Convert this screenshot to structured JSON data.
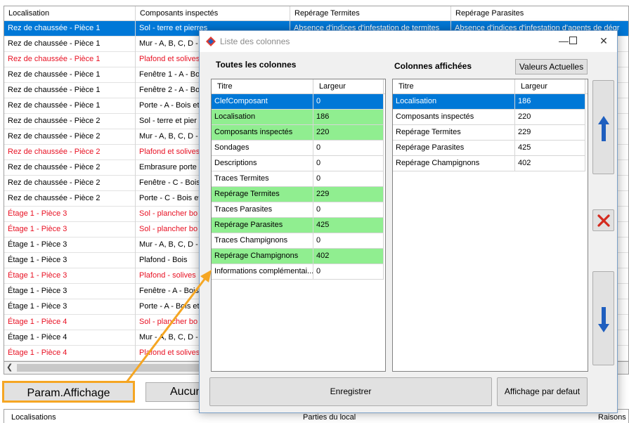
{
  "background": {
    "columns": [
      "Localisation",
      "Composants inspectés",
      "Repérage Termites",
      "Repérage Parasites"
    ],
    "rows": [
      {
        "loc": "Rez de chaussée - Pièce 1",
        "comp": "Sol - terre et pierres",
        "termites": "Absence d'indices d'infestation de termites",
        "parasites": "Absence d'indices d'infestation d'agents de dégr",
        "style": "selected"
      },
      {
        "loc": "Rez de chaussée - Pièce 1",
        "comp": "Mur - A, B, C, D -",
        "termites": "",
        "parasites": "",
        "style": "normal"
      },
      {
        "loc": "Rez de chaussée - Pièce 1",
        "comp": "Plafond et solives",
        "termites": "",
        "parasites": "ur",
        "style": "red"
      },
      {
        "loc": "Rez de chaussée - Pièce 1",
        "comp": "Fenêtre 1 - A - Bo",
        "termites": "",
        "parasites": "égr",
        "style": "normal"
      },
      {
        "loc": "Rez de chaussée - Pièce 1",
        "comp": "Fenêtre 2 - A - Bo",
        "termites": "",
        "parasites": "égr",
        "style": "normal"
      },
      {
        "loc": "Rez de chaussée - Pièce 1",
        "comp": "Porte - A - Bois et",
        "termites": "",
        "parasites": "égr",
        "style": "normal"
      },
      {
        "loc": "Rez de chaussée - Pièce 2",
        "comp": "Sol - terre et pier",
        "termites": "",
        "parasites": "égr",
        "style": "normal"
      },
      {
        "loc": "Rez de chaussée - Pièce 2",
        "comp": "Mur - A, B, C, D -",
        "termites": "",
        "parasites": "égr",
        "style": "normal"
      },
      {
        "loc": "Rez de chaussée - Pièce 2",
        "comp": "Plafond et solives",
        "termites": "",
        "parasites": "ur",
        "style": "red"
      },
      {
        "loc": "Rez de chaussée - Pièce 2",
        "comp": "Embrasure porte",
        "termites": "",
        "parasites": "égr",
        "style": "normal"
      },
      {
        "loc": "Rez de chaussée - Pièce 2",
        "comp": "Fenêtre - C - Bois",
        "termites": "",
        "parasites": "égr",
        "style": "normal"
      },
      {
        "loc": "Rez de chaussée - Pièce 2",
        "comp": "Porte - C - Bois et",
        "termites": "",
        "parasites": "égr",
        "style": "normal"
      },
      {
        "loc": "Étage 1 - Pièce 3",
        "comp": "Sol - plancher bo",
        "termites": "",
        "parasites": "ur",
        "style": "red"
      },
      {
        "loc": "Étage 1 - Pièce 3",
        "comp": "Sol - plancher bo",
        "termites": "",
        "parasites": "ur",
        "style": "red"
      },
      {
        "loc": "Étage 1 - Pièce 3",
        "comp": "Mur - A, B, C, D -",
        "termites": "",
        "parasites": "égr",
        "style": "normal"
      },
      {
        "loc": "Étage 1 - Pièce 3",
        "comp": "Plafond - Bois",
        "termites": "",
        "parasites": "égr",
        "style": "normal"
      },
      {
        "loc": "Étage 1 - Pièce 3",
        "comp": "Plafond - solives",
        "termites": "",
        "parasites": "ur",
        "style": "red"
      },
      {
        "loc": "Étage 1 - Pièce 3",
        "comp": "Fenêtre - A - Bois",
        "termites": "",
        "parasites": "égr",
        "style": "normal"
      },
      {
        "loc": "Étage 1 - Pièce 3",
        "comp": "Porte - A - Bois et",
        "termites": "",
        "parasites": "égr",
        "style": "normal"
      },
      {
        "loc": "Étage 1 - Pièce 4",
        "comp": "Sol - plancher bo",
        "termites": "",
        "parasites": "ur",
        "style": "red"
      },
      {
        "loc": "Étage 1 - Pièce 4",
        "comp": "Mur - A, B, C, D -",
        "termites": "",
        "parasites": "égr",
        "style": "normal"
      },
      {
        "loc": "Étage 1 - Pièce 4",
        "comp": "Plafond et solives",
        "termites": "",
        "parasites": "ur",
        "style": "red"
      }
    ],
    "param_button": "Param.Affichage",
    "aucun_button": "Aucun",
    "bottom_headers": [
      "Localisations",
      "Parties du local",
      "Raisons"
    ]
  },
  "dialog": {
    "title": "Liste des colonnes",
    "left_label": "Toutes les colonnes",
    "right_label": "Colonnes affichées",
    "valeurs_button": "Valeurs Actuelles",
    "col_titre": "Titre",
    "col_largeur": "Largeur",
    "all_columns": [
      {
        "titre": "ClefComposant",
        "largeur": "0",
        "state": "selected"
      },
      {
        "titre": "Localisation",
        "largeur": "186",
        "state": "displayed"
      },
      {
        "titre": "Composants inspectés",
        "largeur": "220",
        "state": "displayed"
      },
      {
        "titre": "Sondages",
        "largeur": "0",
        "state": "normal"
      },
      {
        "titre": "Descriptions",
        "largeur": "0",
        "state": "normal"
      },
      {
        "titre": "Traces Termites",
        "largeur": "0",
        "state": "normal"
      },
      {
        "titre": "Repérage Termites",
        "largeur": "229",
        "state": "displayed"
      },
      {
        "titre": "Traces Parasites",
        "largeur": "0",
        "state": "normal"
      },
      {
        "titre": "Repérage Parasites",
        "largeur": "425",
        "state": "displayed"
      },
      {
        "titre": "Traces Champignons",
        "largeur": "0",
        "state": "normal"
      },
      {
        "titre": "Repérage Champignons",
        "largeur": "402",
        "state": "displayed"
      },
      {
        "titre": "Informations complémentai...",
        "largeur": "0",
        "state": "normal"
      }
    ],
    "displayed_columns": [
      {
        "titre": "Localisation",
        "largeur": "186",
        "state": "selected"
      },
      {
        "titre": "Composants inspectés",
        "largeur": "220",
        "state": "normal"
      },
      {
        "titre": "Repérage Termites",
        "largeur": "229",
        "state": "normal"
      },
      {
        "titre": "Repérage Parasites",
        "largeur": "425",
        "state": "normal"
      },
      {
        "titre": "Repérage Champignons",
        "largeur": "402",
        "state": "normal"
      }
    ],
    "save_button": "Enregistrer",
    "default_button": "Affichage par defaut"
  },
  "colors": {
    "selection": "#0078d7",
    "displayed": "#90ee90",
    "red_text": "#e81123",
    "annotation": "#f5a623"
  },
  "icons": [
    "app-logo-icon",
    "minimize-icon",
    "maximize-icon",
    "close-icon",
    "arrow-up-icon",
    "delete-x-icon",
    "arrow-down-icon",
    "scroll-left-icon"
  ]
}
